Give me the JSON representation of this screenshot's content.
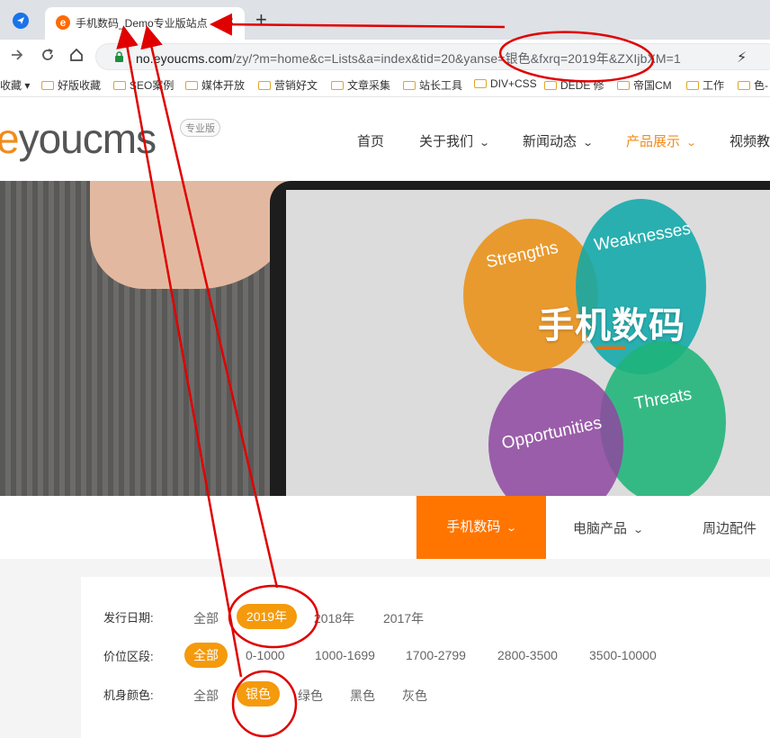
{
  "browser": {
    "tab_title": "手机数码_Demo专业版站点",
    "tab_close": "×",
    "new_tab": "+",
    "url_host": "no.eyoucms.com",
    "url_path": "/zy/?m=home&c=Lists&a=index&tid=20&yanse=银色&fxrq=2019年&ZXIjbXM=1",
    "bookmarks": [
      "收藏",
      "好版收藏",
      "SEO案例",
      "媒体开放",
      "营销好文",
      "文章采集",
      "站长工具",
      "DIV+CSS",
      "DEDE 修",
      "帝国CM",
      "工作",
      "色-"
    ]
  },
  "site": {
    "logo_e": "e",
    "logo_rest": "youcms",
    "logo_badge": "专业版",
    "nav": [
      "首页",
      "关于我们",
      "新闻动态",
      "产品展示",
      "视频教"
    ],
    "nav_chevron": "⌄"
  },
  "banner": {
    "title": "手机数码",
    "circles": [
      "Strengths",
      "Weaknesses",
      "Threats",
      "Opportunities"
    ]
  },
  "subnav": {
    "active": "手机数码",
    "items": [
      "电脑产品",
      "周边配件"
    ],
    "chevron": "⌄"
  },
  "filters": {
    "release_date": {
      "label": "发行日期:",
      "options": [
        "全部",
        "2019年",
        "2018年",
        "2017年"
      ],
      "selected": "2019年"
    },
    "price": {
      "label": "价位区段:",
      "options": [
        "全部",
        "0-1000",
        "1000-1699",
        "1700-2799",
        "2800-3500",
        "3500-10000"
      ],
      "selected": "全部"
    },
    "color": {
      "label": "机身颜色:",
      "options": [
        "全部",
        "银色",
        "绿色",
        "黑色",
        "灰色"
      ],
      "selected": "银色"
    }
  },
  "colors": {
    "accent": "#ff7500",
    "pill": "#f49a0c",
    "annotation": "#e00000"
  }
}
